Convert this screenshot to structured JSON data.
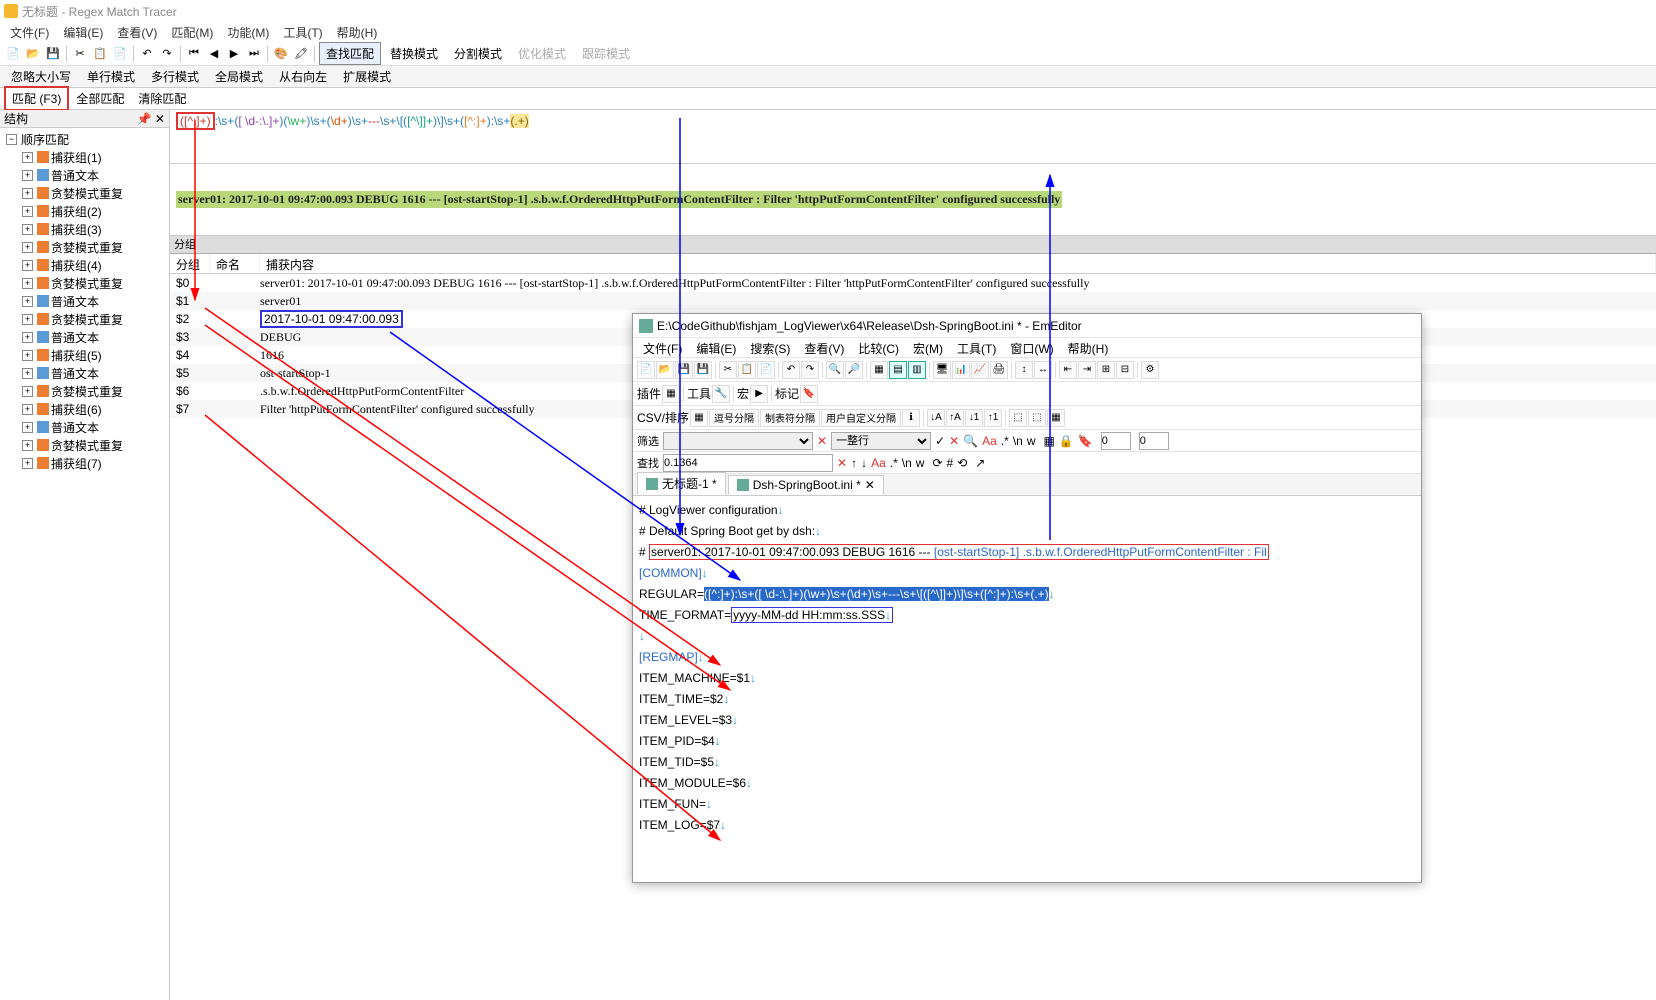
{
  "app": {
    "title": "无标题 - Regex Match Tracer"
  },
  "menu": [
    "文件(F)",
    "编辑(E)",
    "查看(V)",
    "匹配(M)",
    "功能(M)",
    "工具(T)",
    "帮助(H)"
  ],
  "toolbar1_modes": [
    "查找匹配",
    "替换模式",
    "分割模式",
    "优化模式",
    "跟踪模式"
  ],
  "toolbar1_active": "查找匹配",
  "toolbar2": [
    "忽略大小写",
    "单行模式",
    "多行模式",
    "全局模式",
    "从右向左",
    "扩展模式"
  ],
  "match_buttons": {
    "boxed": "匹配 (F3)",
    "all": "全部匹配",
    "clear": "清除匹配"
  },
  "left_panel": {
    "title": "结构",
    "root": "顺序匹配",
    "items": [
      {
        "label": "捕获组(1)",
        "icon": "orange"
      },
      {
        "label": "普通文本",
        "icon": "blue"
      },
      {
        "label": "贪婪模式重复",
        "icon": "orange"
      },
      {
        "label": "捕获组(2)",
        "icon": "orange"
      },
      {
        "label": "捕获组(3)",
        "icon": "orange"
      },
      {
        "label": "贪婪模式重复",
        "icon": "orange"
      },
      {
        "label": "捕获组(4)",
        "icon": "orange"
      },
      {
        "label": "贪婪模式重复",
        "icon": "orange"
      },
      {
        "label": "普通文本",
        "icon": "blue"
      },
      {
        "label": "贪婪模式重复",
        "icon": "orange"
      },
      {
        "label": "普通文本",
        "icon": "blue"
      },
      {
        "label": "捕获组(5)",
        "icon": "orange"
      },
      {
        "label": "普通文本",
        "icon": "blue"
      },
      {
        "label": "贪婪模式重复",
        "icon": "orange"
      },
      {
        "label": "捕获组(6)",
        "icon": "orange"
      },
      {
        "label": "普通文本",
        "icon": "blue"
      },
      {
        "label": "贪婪模式重复",
        "icon": "orange"
      },
      {
        "label": "捕获组(7)",
        "icon": "orange"
      }
    ]
  },
  "regex": {
    "p0": "([^:]+)",
    "p1": ":\\s+(",
    "p2": "[ \\d-:\\.]+",
    "p3": ")(",
    "p4": "\\w+",
    "p5": ")\\s+(",
    "p6": "\\d+",
    "p7": ")\\s+",
    "p8": "---",
    "p9": "\\s+\\[(",
    "p10": "[^\\]]+",
    "p11": ")\\]\\s+(",
    "p12": "[^:]+",
    "p13": "):\\s+",
    "p14": "(.+)"
  },
  "match_text": "server01:  2017-10-01 09:47:00.093 DEBUG 1616 --- [ost-startStop-1] .s.b.w.f.OrderedHttpPutFormContentFilter : Filter 'httpPutFormContentFilter' configured successfully",
  "groups_section": "分组",
  "groups_cols": {
    "c0": "分组",
    "c1": "命名",
    "c2": "捕获内容"
  },
  "groups": [
    {
      "n": "$0",
      "v": "server01:  2017-10-01 09:47:00.093 DEBUG 1616 --- [ost-startStop-1] .s.b.w.f.OrderedHttpPutFormContentFilter : Filter 'httpPutFormContentFilter' configured successfully"
    },
    {
      "n": "$1",
      "v": "server01"
    },
    {
      "n": "$2",
      "v": " 2017-10-01 09:47:00.093 "
    },
    {
      "n": "$3",
      "v": "DEBUG"
    },
    {
      "n": "$4",
      "v": "1616"
    },
    {
      "n": "$5",
      "v": "ost-startStop-1"
    },
    {
      "n": "$6",
      "v": ".s.b.w.f.OrderedHttpPutFormContentFilter"
    },
    {
      "n": "$7",
      "v": "Filter 'httpPutFormContentFilter' configured successfully"
    }
  ],
  "em": {
    "title": "E:\\CodeGithub\\fishjam_LogViewer\\x64\\Release\\Dsh-SpringBoot.ini * - EmEditor",
    "menu": [
      "文件(F)",
      "编辑(E)",
      "搜索(S)",
      "查看(V)",
      "比较(C)",
      "宏(M)",
      "工具(T)",
      "窗口(W)",
      "帮助(H)"
    ],
    "tb_labels": {
      "plugin": "插件",
      "tool": "工具",
      "macro": "宏",
      "mark": "标记"
    },
    "csv_label": "CSV/排序",
    "csv_btns": [
      "逗号分隔",
      "制表符分隔",
      "用户自定义分隔"
    ],
    "filter_label": "筛选",
    "line_label": "一整行",
    "find_label": "查找",
    "find_value": "0.1364",
    "zero1": "0",
    "zero2": "0",
    "tabs": [
      {
        "label": "无标题-1 *"
      },
      {
        "label": "Dsh-SpringBoot.ini *"
      }
    ],
    "lines": {
      "l1": "# LogViewer configuration",
      "l2": "# Default Spring Boot get by dsh:",
      "l3a": "#",
      "l3b": "server01:  2017-10-01 09:47:00.093 DEBUG 1616 ---",
      "l3c": "[ost-startStop-1] .s.b.w.f.OrderedHttpPutFormContentFilter : Fil",
      "l4": "[COMMON]",
      "l5a": "REGULAR=",
      "l5b": "([^:]+):\\s+([ \\d-:\\.]+)(\\w+)\\s+(\\d+)\\s+---\\s+\\[([^\\]]+)\\]\\s+([^:]+):\\s+(.+)",
      "l6a": "TIME_FORMAT=",
      "l6b": "yyyy-MM-dd HH:mm:ss.SSS",
      "l8": "[REGMAP]",
      "l9": "ITEM_MACHINE=$1",
      "l10": "ITEM_TIME=$2",
      "l11": "ITEM_LEVEL=$3",
      "l12": "ITEM_PID=$4",
      "l13": "ITEM_TID=$5",
      "l14": "ITEM_MODULE=$6",
      "l15": "ITEM_FUN=",
      "l16": "ITEM_LOG=$7"
    }
  }
}
